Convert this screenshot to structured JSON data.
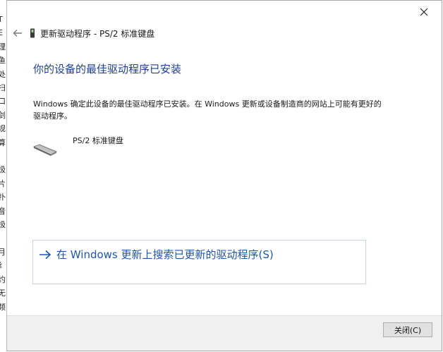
{
  "background_window": {
    "chars": [
      "T",
      "E",
      "理",
      "鱼",
      "处",
      "扫",
      "口",
      "剑",
      "规",
      "算",
      "|",
      "极",
      "片",
      "扑",
      "音",
      "极",
      "",
      "月",
      "纟",
      "约",
      "无",
      "频"
    ]
  },
  "dialog": {
    "header_title": "更新驱动程序 - PS/2 标准键盘",
    "heading": "你的设备的最佳驱动程序已安装",
    "description": "Windows 确定此设备的最佳驱动程序已安装。在 Windows 更新或设备制造商的网站上可能有更好的驱动程序。",
    "device_name": "PS/2 标准键盘",
    "search_link": "在 Windows 更新上搜索已更新的驱动程序(S)",
    "close_button": "关闭(C)"
  },
  "icons": {
    "close": "close-icon",
    "back": "back-arrow-icon",
    "header_device": "device-icon",
    "keyboard": "keyboard-icon",
    "link_arrow": "arrow-right-icon"
  },
  "colors": {
    "heading": "#1e3f8f",
    "link": "#1e56a8",
    "footer_bg": "#f0f0f0"
  }
}
